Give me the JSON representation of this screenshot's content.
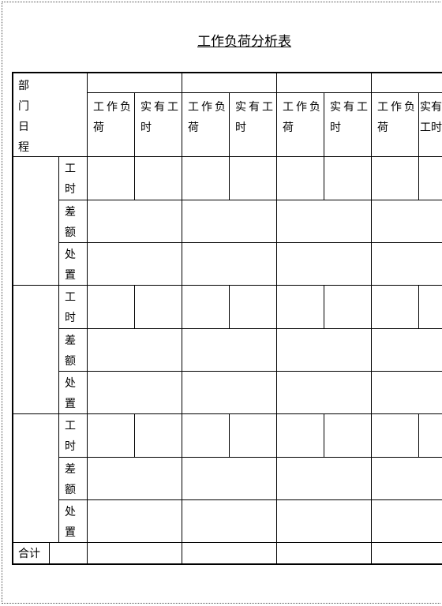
{
  "title": "工作负荷分析表",
  "header": {
    "dept_label": "部门日程",
    "columns": [
      "工作负荷",
      "实有工时",
      "工作负荷",
      "实有工时",
      "工作负荷",
      "实有工时",
      "工作负荷",
      "实有工时"
    ]
  },
  "row_labels": [
    "工时",
    "差额",
    "处置"
  ],
  "total_label": "合计"
}
